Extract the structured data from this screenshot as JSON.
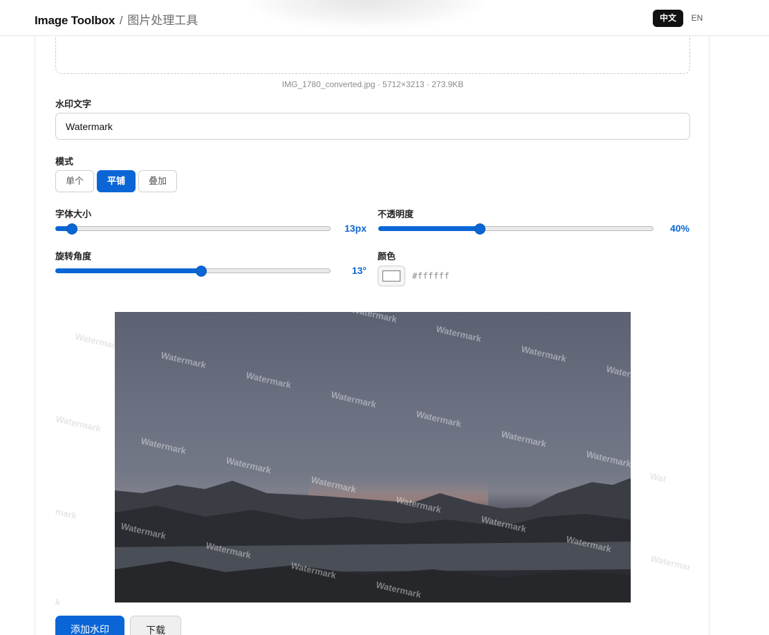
{
  "header": {
    "title": "Image Toolbox",
    "separator": "/",
    "subtitle": "图片处理工具",
    "lang_zh": "中文",
    "lang_en": "EN"
  },
  "file_info": "IMG_1780_converted.jpg · 5712×3213 · 273.9KB",
  "watermark_text": {
    "label": "水印文字",
    "value": "Watermark"
  },
  "mode": {
    "label": "模式",
    "options": [
      "单个",
      "平铺",
      "叠加"
    ],
    "selected": "平铺"
  },
  "font_size": {
    "label": "字体大小",
    "value_text": "13px",
    "level": 0.06
  },
  "opacity": {
    "label": "不透明度",
    "value_text": "40%",
    "level": 0.37
  },
  "rotation": {
    "label": "旋转角度",
    "value_text": "13°",
    "level": 0.53
  },
  "color": {
    "label": "颜色",
    "value": "#ffffff"
  },
  "preview": {
    "watermark_word": "Watermark",
    "partial_1": "Wat",
    "partial_2": "mark",
    "partial_3": "k"
  },
  "actions": {
    "add": "添加水印",
    "download": "下载"
  },
  "colors": {
    "accent": "#0a66d6",
    "header_active": "#111111"
  }
}
